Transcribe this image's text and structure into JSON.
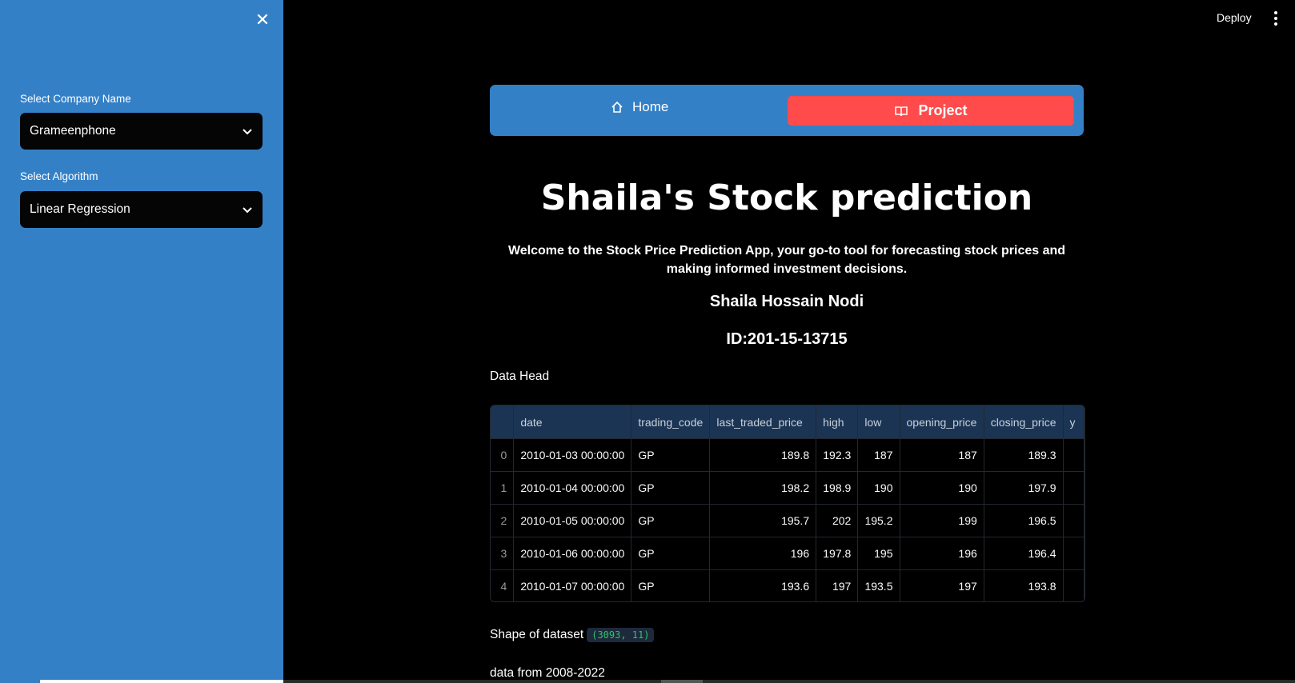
{
  "sidebar": {
    "company_label": "Select Company Name",
    "company_value": "Grameenphone",
    "algorithm_label": "Select Algorithm",
    "algorithm_value": "Linear Regression"
  },
  "header": {
    "deploy_label": "Deploy"
  },
  "nav": {
    "home_label": "Home",
    "project_label": "Project"
  },
  "main": {
    "title": "Shaila's Stock prediction",
    "welcome": "Welcome to the Stock Price Prediction App, your go-to tool for forecasting stock prices and making informed investment decisions.",
    "author": "Shaila Hossain Nodi",
    "id_text": "ID:201-15-13715",
    "data_head_label": "Data Head",
    "shape_label": "Shape of dataset",
    "shape_value": "(3093, 11)",
    "data_range_label": "data from 2008-2022"
  },
  "table": {
    "columns": [
      "",
      "date",
      "trading_code",
      "last_traded_price",
      "high",
      "low",
      "opening_price",
      "closing_price",
      "y"
    ],
    "rows": [
      [
        "0",
        "2010-01-03 00:00:00",
        "GP",
        "189.8",
        "192.3",
        "187",
        "187",
        "189.3",
        ""
      ],
      [
        "1",
        "2010-01-04 00:00:00",
        "GP",
        "198.2",
        "198.9",
        "190",
        "190",
        "197.9",
        ""
      ],
      [
        "2",
        "2010-01-05 00:00:00",
        "GP",
        "195.7",
        "202",
        "195.2",
        "199",
        "196.5",
        ""
      ],
      [
        "3",
        "2010-01-06 00:00:00",
        "GP",
        "196",
        "197.8",
        "195",
        "196",
        "196.4",
        ""
      ],
      [
        "4",
        "2010-01-07 00:00:00",
        "GP",
        "193.6",
        "197",
        "193.5",
        "197",
        "193.8",
        ""
      ]
    ]
  },
  "colors": {
    "sidebar": "#3480c7",
    "accent": "#ff4b4b",
    "background": "#000000"
  }
}
